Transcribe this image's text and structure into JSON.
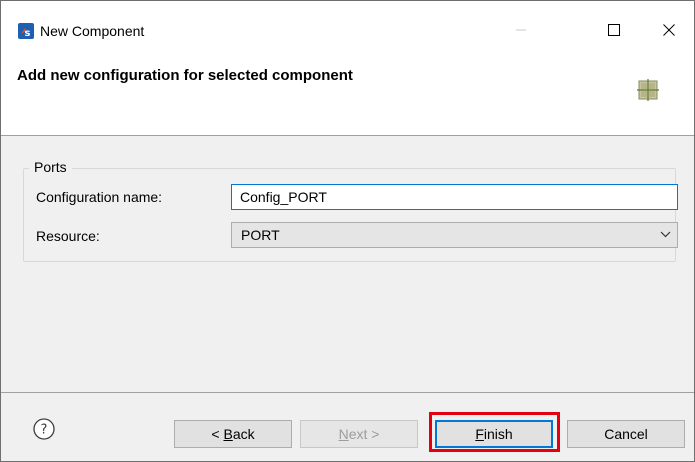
{
  "window": {
    "title": "New Component",
    "app_icon": "s32-design-studio-icon"
  },
  "title_bar_buttons": [
    "minimize-icon",
    "maximize-icon",
    "close-icon"
  ],
  "header": {
    "title": "Add new configuration for selected component",
    "icon": "component-grid-icon"
  },
  "group": {
    "legend": "Ports",
    "config_name_label": "Configuration name:",
    "config_name_value": "Config_PORT",
    "resource_label": "Resource:",
    "resource_value": "PORT"
  },
  "buttons": {
    "back": {
      "mnemonic": "B",
      "suffix": "ack",
      "prefix": "< "
    },
    "next": {
      "mnemonic": "N",
      "suffix": "ext >"
    },
    "finish": {
      "mnemonic": "F",
      "suffix": "inish"
    },
    "cancel": "Cancel"
  },
  "help_icon": "help-icon",
  "colors": {
    "focus_border": "#0078d7",
    "highlight": "#e3000f",
    "app_icon_blue": "#1f5fb2"
  }
}
